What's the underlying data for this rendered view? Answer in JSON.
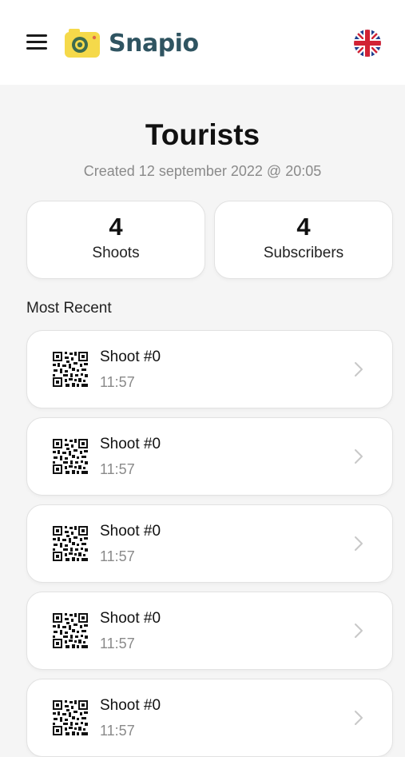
{
  "header": {
    "brand": "Snapio",
    "menu_icon": "hamburger-menu-icon",
    "logo_icon": "camera-icon",
    "language_icon": "uk-flag-icon",
    "brand_color": "#2f5461",
    "logo_accent": "#f5d94a"
  },
  "group": {
    "title": "Tourists",
    "created": "Created 12 september 2022 @ 20:05"
  },
  "stats": [
    {
      "value": "4",
      "label": "Shoots"
    },
    {
      "value": "4",
      "label": "Subscribers"
    }
  ],
  "recent": {
    "heading": "Most Recent",
    "items": [
      {
        "name": "Shoot #0",
        "time": "11:57",
        "icon": "qr-code-icon"
      },
      {
        "name": "Shoot #0",
        "time": "11:57",
        "icon": "qr-code-icon"
      },
      {
        "name": "Shoot #0",
        "time": "11:57",
        "icon": "qr-code-icon"
      },
      {
        "name": "Shoot #0",
        "time": "11:57",
        "icon": "qr-code-icon"
      },
      {
        "name": "Shoot #0",
        "time": "11:57",
        "icon": "qr-code-icon"
      }
    ]
  }
}
